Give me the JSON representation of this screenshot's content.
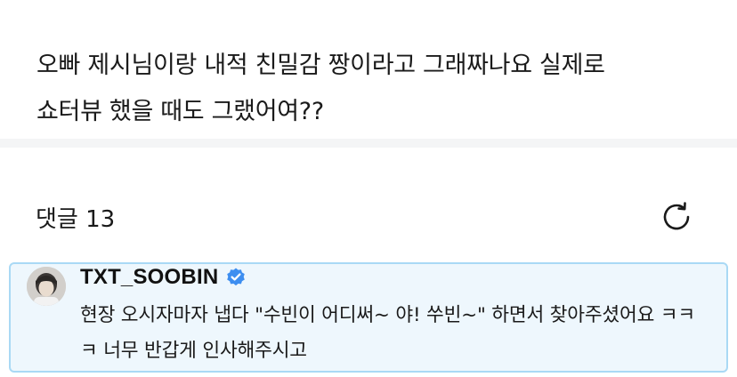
{
  "post": {
    "text": "오빠 제시님이랑 내적 친밀감 짱이라고 그래짜나요 실제로\n쇼터뷰 했을 때도 그랬어여??"
  },
  "comments_section": {
    "count_label": "댓글 13",
    "refresh_icon": "refresh-icon"
  },
  "pinned_comment": {
    "author": "TXT_SOOBIN",
    "verified_icon": "verified-badge-icon",
    "text": "현장 오시자마자 냅다 \"수빈이 어디써~ 야! 쑤빈~\" 하면서 찾아주셨어요 ㅋㅋㅋ 너무 반갑게 인사해주시고",
    "highlight_border": "#a9d9f5",
    "highlight_bg": "#eef7fd"
  },
  "colors": {
    "verified": "#3d8ef0",
    "divider": "#f4f5f6"
  }
}
